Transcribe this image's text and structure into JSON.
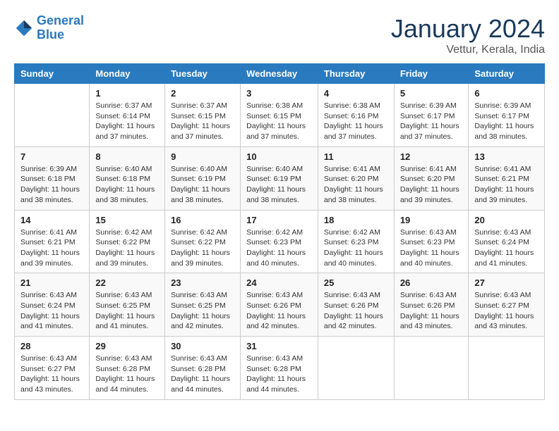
{
  "header": {
    "logo_line1": "General",
    "logo_line2": "Blue",
    "month": "January 2024",
    "location": "Vettur, Kerala, India"
  },
  "days_of_week": [
    "Sunday",
    "Monday",
    "Tuesday",
    "Wednesday",
    "Thursday",
    "Friday",
    "Saturday"
  ],
  "weeks": [
    [
      {
        "num": "",
        "info": ""
      },
      {
        "num": "1",
        "info": "Sunrise: 6:37 AM\nSunset: 6:14 PM\nDaylight: 11 hours and 37 minutes."
      },
      {
        "num": "2",
        "info": "Sunrise: 6:37 AM\nSunset: 6:15 PM\nDaylight: 11 hours and 37 minutes."
      },
      {
        "num": "3",
        "info": "Sunrise: 6:38 AM\nSunset: 6:15 PM\nDaylight: 11 hours and 37 minutes."
      },
      {
        "num": "4",
        "info": "Sunrise: 6:38 AM\nSunset: 6:16 PM\nDaylight: 11 hours and 37 minutes."
      },
      {
        "num": "5",
        "info": "Sunrise: 6:39 AM\nSunset: 6:17 PM\nDaylight: 11 hours and 37 minutes."
      },
      {
        "num": "6",
        "info": "Sunrise: 6:39 AM\nSunset: 6:17 PM\nDaylight: 11 hours and 38 minutes."
      }
    ],
    [
      {
        "num": "7",
        "info": "Sunrise: 6:39 AM\nSunset: 6:18 PM\nDaylight: 11 hours and 38 minutes."
      },
      {
        "num": "8",
        "info": "Sunrise: 6:40 AM\nSunset: 6:18 PM\nDaylight: 11 hours and 38 minutes."
      },
      {
        "num": "9",
        "info": "Sunrise: 6:40 AM\nSunset: 6:19 PM\nDaylight: 11 hours and 38 minutes."
      },
      {
        "num": "10",
        "info": "Sunrise: 6:40 AM\nSunset: 6:19 PM\nDaylight: 11 hours and 38 minutes."
      },
      {
        "num": "11",
        "info": "Sunrise: 6:41 AM\nSunset: 6:20 PM\nDaylight: 11 hours and 38 minutes."
      },
      {
        "num": "12",
        "info": "Sunrise: 6:41 AM\nSunset: 6:20 PM\nDaylight: 11 hours and 39 minutes."
      },
      {
        "num": "13",
        "info": "Sunrise: 6:41 AM\nSunset: 6:21 PM\nDaylight: 11 hours and 39 minutes."
      }
    ],
    [
      {
        "num": "14",
        "info": "Sunrise: 6:41 AM\nSunset: 6:21 PM\nDaylight: 11 hours and 39 minutes."
      },
      {
        "num": "15",
        "info": "Sunrise: 6:42 AM\nSunset: 6:22 PM\nDaylight: 11 hours and 39 minutes."
      },
      {
        "num": "16",
        "info": "Sunrise: 6:42 AM\nSunset: 6:22 PM\nDaylight: 11 hours and 39 minutes."
      },
      {
        "num": "17",
        "info": "Sunrise: 6:42 AM\nSunset: 6:23 PM\nDaylight: 11 hours and 40 minutes."
      },
      {
        "num": "18",
        "info": "Sunrise: 6:42 AM\nSunset: 6:23 PM\nDaylight: 11 hours and 40 minutes."
      },
      {
        "num": "19",
        "info": "Sunrise: 6:43 AM\nSunset: 6:23 PM\nDaylight: 11 hours and 40 minutes."
      },
      {
        "num": "20",
        "info": "Sunrise: 6:43 AM\nSunset: 6:24 PM\nDaylight: 11 hours and 41 minutes."
      }
    ],
    [
      {
        "num": "21",
        "info": "Sunrise: 6:43 AM\nSunset: 6:24 PM\nDaylight: 11 hours and 41 minutes."
      },
      {
        "num": "22",
        "info": "Sunrise: 6:43 AM\nSunset: 6:25 PM\nDaylight: 11 hours and 41 minutes."
      },
      {
        "num": "23",
        "info": "Sunrise: 6:43 AM\nSunset: 6:25 PM\nDaylight: 11 hours and 42 minutes."
      },
      {
        "num": "24",
        "info": "Sunrise: 6:43 AM\nSunset: 6:26 PM\nDaylight: 11 hours and 42 minutes."
      },
      {
        "num": "25",
        "info": "Sunrise: 6:43 AM\nSunset: 6:26 PM\nDaylight: 11 hours and 42 minutes."
      },
      {
        "num": "26",
        "info": "Sunrise: 6:43 AM\nSunset: 6:26 PM\nDaylight: 11 hours and 43 minutes."
      },
      {
        "num": "27",
        "info": "Sunrise: 6:43 AM\nSunset: 6:27 PM\nDaylight: 11 hours and 43 minutes."
      }
    ],
    [
      {
        "num": "28",
        "info": "Sunrise: 6:43 AM\nSunset: 6:27 PM\nDaylight: 11 hours and 43 minutes."
      },
      {
        "num": "29",
        "info": "Sunrise: 6:43 AM\nSunset: 6:28 PM\nDaylight: 11 hours and 44 minutes."
      },
      {
        "num": "30",
        "info": "Sunrise: 6:43 AM\nSunset: 6:28 PM\nDaylight: 11 hours and 44 minutes."
      },
      {
        "num": "31",
        "info": "Sunrise: 6:43 AM\nSunset: 6:28 PM\nDaylight: 11 hours and 44 minutes."
      },
      {
        "num": "",
        "info": ""
      },
      {
        "num": "",
        "info": ""
      },
      {
        "num": "",
        "info": ""
      }
    ]
  ]
}
